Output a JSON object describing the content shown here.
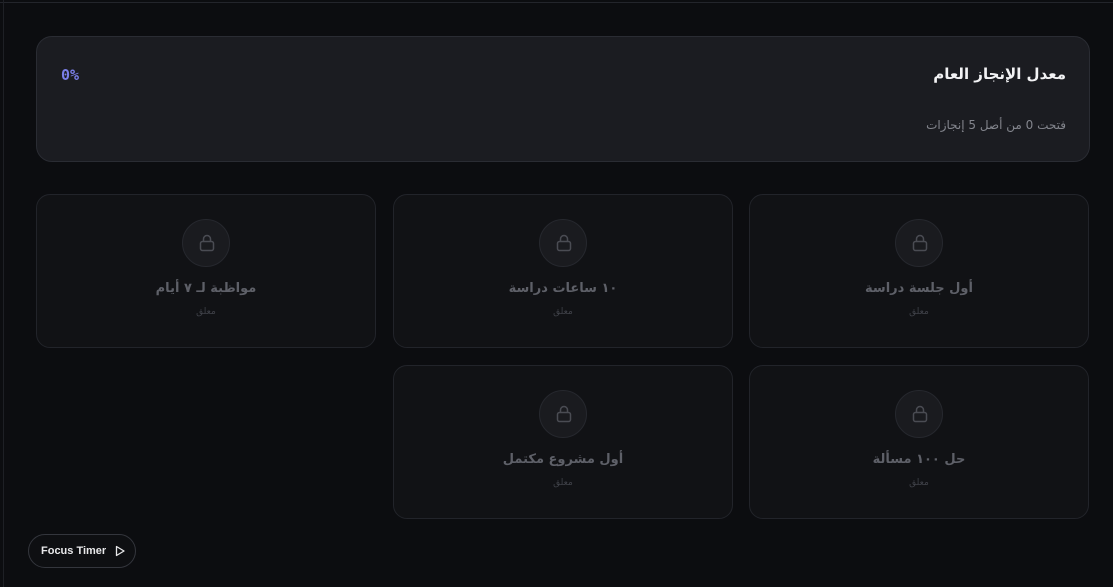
{
  "summary": {
    "title": "معدل الإنجاز العام",
    "percent": "0%",
    "subtitle": "فتحت 0 من أصل 5 إنجازات"
  },
  "achievements": [
    {
      "title": "أول جلسة دراسة",
      "status": "معلق",
      "icon": "lock-icon"
    },
    {
      "title": "١٠ ساعات دراسة",
      "status": "معلق",
      "icon": "lock-icon"
    },
    {
      "title": "مواظبة لـ ٧ أيام",
      "status": "معلق",
      "icon": "lock-icon"
    },
    {
      "title": "حل ١٠٠ مسألة",
      "status": "معلق",
      "icon": "lock-icon"
    },
    {
      "title": "أول مشروع مكتمل",
      "status": "معلق",
      "icon": "lock-icon"
    }
  ],
  "focus_timer": {
    "label": "Focus Timer",
    "icon": "play-icon"
  },
  "colors": {
    "background": "#0c0d10",
    "card": "#1b1c21",
    "accent": "#7a7fe8"
  }
}
